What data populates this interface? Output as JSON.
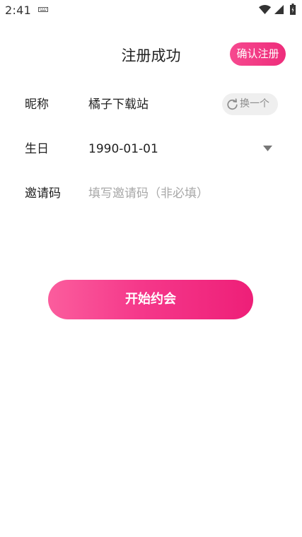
{
  "status_bar": {
    "time": "2:41",
    "icons": [
      "keyboard-icon",
      "wifi-icon",
      "signal-icon",
      "battery-icon"
    ]
  },
  "header": {
    "title": "注册成功",
    "confirm_label": "确认注册"
  },
  "form": {
    "nickname": {
      "label": "昵称",
      "value": "橘子下载站",
      "refresh_label": "换一个",
      "refresh_icon": "refresh-icon"
    },
    "birthday": {
      "label": "生日",
      "value": "1990-01-01",
      "dropdown_icon": "chevron-down-icon"
    },
    "invite_code": {
      "label": "邀请码",
      "value": "",
      "placeholder": "填写邀请码（非必填）"
    }
  },
  "actions": {
    "start_label": "开始约会"
  },
  "colors": {
    "accent": "#f13a86",
    "accent_light": "#fb5d9d",
    "accent_dark": "#ee1f78",
    "refresh_bg": "#efefef",
    "placeholder": "#a8a8a8"
  }
}
